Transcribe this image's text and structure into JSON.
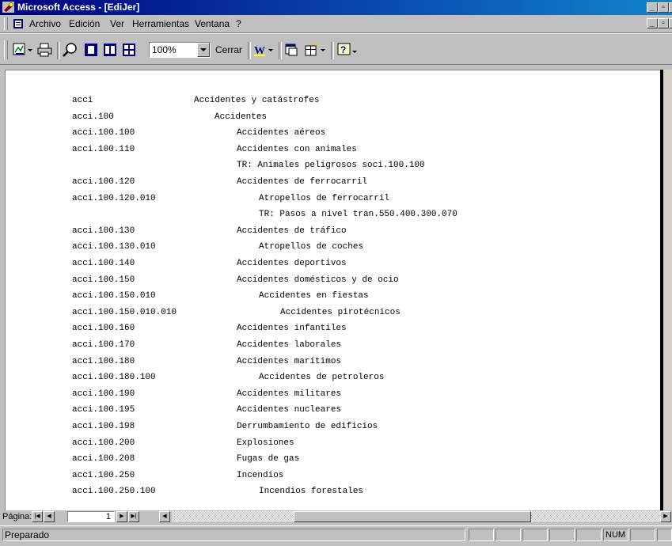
{
  "window": {
    "title": "Microsoft Access - [EdiJer]"
  },
  "menu": {
    "items": [
      {
        "label": "Archivo"
      },
      {
        "label": "Edición"
      },
      {
        "label": "Ver"
      },
      {
        "label": "Herramientas"
      },
      {
        "label": "Ventana"
      },
      {
        "label": "?"
      }
    ]
  },
  "toolbar": {
    "zoom": "100%",
    "close_label": "Cerrar",
    "icons": [
      "view-icon",
      "print-icon",
      "zoom-icon",
      "one-page-icon",
      "two-pages-icon",
      "multiple-pages-icon",
      "word-icon",
      "database-window-icon",
      "new-object-icon",
      "help-icon"
    ]
  },
  "report": {
    "rows": [
      {
        "code": "acci",
        "desc": "Accidentes y catástrofes",
        "level": 0
      },
      {
        "code": "acci.100",
        "desc": "Accidentes",
        "level": 1
      },
      {
        "code": "acci.100.100",
        "desc": "Accidentes aéreos",
        "level": 2
      },
      {
        "code": "acci.100.110",
        "desc": "Accidentes con animales",
        "level": 2
      },
      {
        "code": "",
        "desc": "TR:  Animales peligrosos   soci.100.100",
        "level": 2
      },
      {
        "code": "acci.100.120",
        "desc": "Accidentes de ferrocarril",
        "level": 2
      },
      {
        "code": "acci.100.120.010",
        "desc": "Atropellos de ferrocarril",
        "level": 3
      },
      {
        "code": "",
        "desc": "TR:  Pasos a nivel   tran.550.400.300.070",
        "level": 3
      },
      {
        "code": "acci.100.130",
        "desc": "Accidentes de tráfico",
        "level": 2
      },
      {
        "code": "acci.100.130.010",
        "desc": "Atropellos de coches",
        "level": 3
      },
      {
        "code": "acci.100.140",
        "desc": "Accidentes deportivos",
        "level": 2
      },
      {
        "code": "acci.100.150",
        "desc": "Accidentes domésticos y de ocio",
        "level": 2
      },
      {
        "code": "acci.100.150.010",
        "desc": "Accidentes en fiestas",
        "level": 3
      },
      {
        "code": "acci.100.150.010.010",
        "desc": "Accidentes pirotécnicos",
        "level": 4
      },
      {
        "code": "acci.100.160",
        "desc": "Accidentes infantiles",
        "level": 2
      },
      {
        "code": "acci.100.170",
        "desc": "Accidentes laborales",
        "level": 2
      },
      {
        "code": "acci.100.180",
        "desc": "Accidentes marítimos",
        "level": 2
      },
      {
        "code": "acci.100.180.100",
        "desc": "Accidentes de petroleros",
        "level": 3
      },
      {
        "code": "acci.100.190",
        "desc": "Accidentes militares",
        "level": 2
      },
      {
        "code": "acci.100.195",
        "desc": "Accidentes nucleares",
        "level": 2
      },
      {
        "code": "acci.100.198",
        "desc": "Derrumbamiento de edificios",
        "level": 2
      },
      {
        "code": "acci.100.200",
        "desc": "Explosiones",
        "level": 2
      },
      {
        "code": "acci.100.208",
        "desc": "Fugas de gas",
        "level": 2
      },
      {
        "code": "acci.100.250",
        "desc": "Incendios",
        "level": 2
      },
      {
        "code": "acci.100.250.100",
        "desc": "Incendios forestales",
        "level": 3
      }
    ]
  },
  "nav": {
    "label": "Página:",
    "page": "1"
  },
  "status": {
    "text": "Preparado",
    "num": "NUM"
  }
}
